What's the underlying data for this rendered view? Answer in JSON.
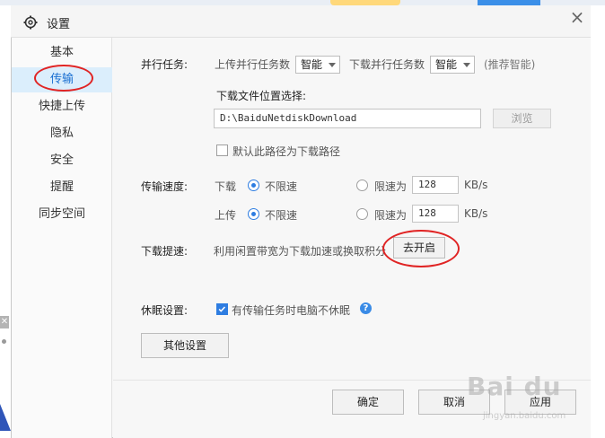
{
  "window": {
    "title": "设置"
  },
  "sidebar": {
    "items": [
      {
        "label": "基本"
      },
      {
        "label": "传输"
      },
      {
        "label": "快捷上传"
      },
      {
        "label": "隐私"
      },
      {
        "label": "安全"
      },
      {
        "label": "提醒"
      },
      {
        "label": "同步空间"
      }
    ],
    "active": "传输"
  },
  "parallel": {
    "section_label": "并行任务:",
    "upload_label": "上传并行任务数",
    "upload_value": "智能",
    "download_label": "下载并行任务数",
    "download_value": "智能",
    "hint": "(推荐智能)"
  },
  "location": {
    "label": "下载文件位置选择:",
    "path": "D:\\BaiduNetdiskDownload",
    "browse": "浏览",
    "default_checkbox": "默认此路径为下载路径",
    "default_checked": false
  },
  "speed": {
    "section_label": "传输速度:",
    "download_label": "下载",
    "upload_label": "上传",
    "unlimited": "不限速",
    "limit_label": "限速为",
    "download_limit": "128",
    "upload_limit": "128",
    "unit": "KB/s"
  },
  "boost": {
    "section_label": "下载提速:",
    "text": "利用闲置带宽为下载加速或换取积分",
    "button": "去开启"
  },
  "sleep": {
    "section_label": "休眠设置:",
    "checkbox": "有传输任务时电脑不休眠",
    "checked": true
  },
  "other_button": "其他设置",
  "footer": {
    "ok": "确定",
    "cancel": "取消",
    "apply": "应用"
  },
  "watermark": {
    "brand": "Bai du",
    "sub": "jingyan.baidu.com"
  },
  "colors": {
    "accent": "#2e7de1",
    "annotation": "#e02424",
    "active_nav": "#dbeefc"
  }
}
